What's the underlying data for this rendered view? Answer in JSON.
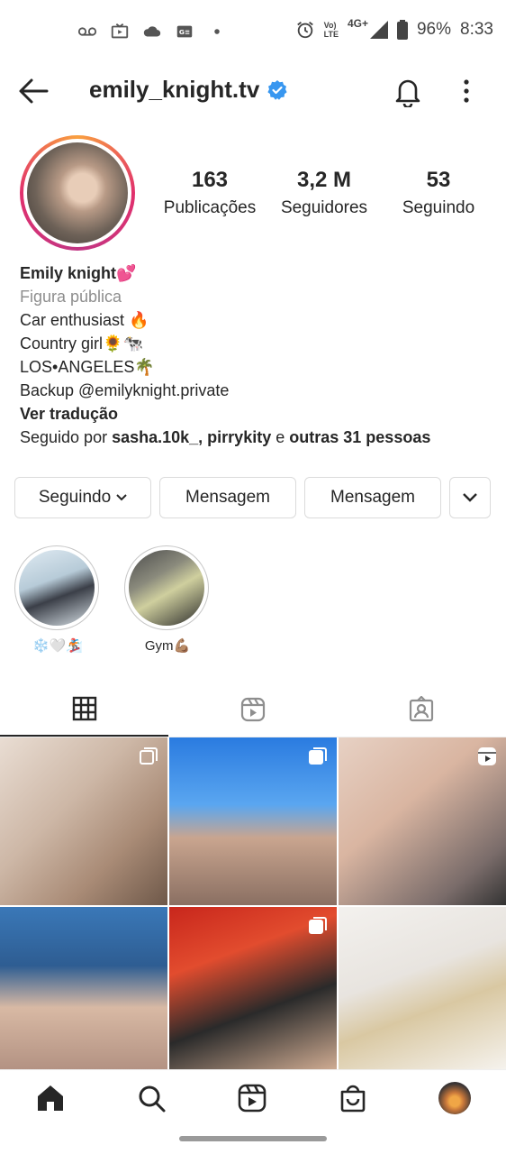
{
  "status_bar": {
    "network_top": "Vo)",
    "network_bottom": "LTE",
    "signal_label": "4G+",
    "battery": "96%",
    "time": "8:33"
  },
  "header": {
    "username": "emily_knight.tv",
    "verified": true
  },
  "profile": {
    "stats": [
      {
        "value": "163",
        "label": "Publicações"
      },
      {
        "value": "3,2 M",
        "label": "Seguidores"
      },
      {
        "value": "53",
        "label": "Seguindo"
      }
    ],
    "bio": {
      "name": "Emily knight💕",
      "category": "Figura pública",
      "lines": [
        "Car enthusiast 🔥",
        "Country girl🌻🐄",
        "LOS•ANGELES🌴",
        "Backup @emilyknight.private"
      ],
      "translate": "Ver tradução",
      "followed_by_prefix": "Seguido por",
      "followed_by_users": "sasha.10k_, pirrykity",
      "followed_by_join": "e",
      "followed_by_others": "outras 31 pessoas"
    }
  },
  "actions": {
    "following": "Seguindo",
    "message1": "Mensagem",
    "message2": "Mensagem"
  },
  "highlights": [
    {
      "label": "❄️🤍🏂"
    },
    {
      "label": "Gym💪🏽"
    }
  ],
  "tabs": [
    "grid-icon",
    "reels-icon",
    "tagged-icon"
  ],
  "bottom_nav": [
    "home-icon",
    "search-icon",
    "reels-icon",
    "shop-icon",
    "profile-avatar"
  ]
}
